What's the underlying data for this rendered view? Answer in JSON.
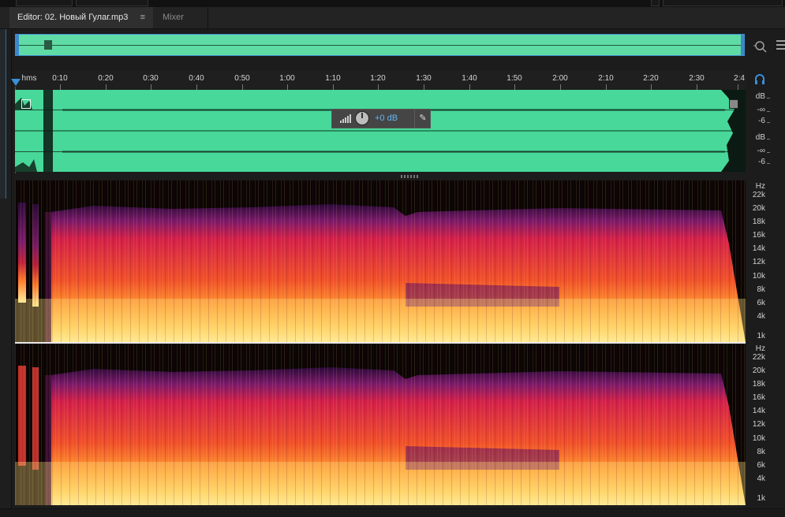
{
  "tabs": {
    "editor_label": "Editor: 02. Новый Гулаг.mp3",
    "editor_menu": "≡",
    "mixer_label": "Mixer"
  },
  "ruler": {
    "unit": "hms",
    "ticks": [
      "0:10",
      "0:20",
      "0:30",
      "0:40",
      "0:50",
      "1:00",
      "1:10",
      "1:20",
      "1:30",
      "1:40",
      "1:50",
      "2:00",
      "2:10",
      "2:20",
      "2:30",
      "2:4"
    ]
  },
  "hud": {
    "gain": "+0 dB"
  },
  "db_scale": {
    "unit": "dB",
    "labels": [
      "-∞",
      "-6"
    ]
  },
  "hz_scale": {
    "unit": "Hz",
    "labels": [
      "22k",
      "20k",
      "18k",
      "16k",
      "14k",
      "12k",
      "10k",
      "8k",
      "6k",
      "4k",
      "1k"
    ]
  },
  "colors": {
    "waveform": "#47d89a",
    "selection_border": "#3f8fd0",
    "hud_value": "#64b6f0"
  },
  "icons": [
    "zoom-icon",
    "list-icon",
    "headphones-icon",
    "pin-icon",
    "knob-icon",
    "level-meter-icon",
    "fade-handle-icon"
  ]
}
